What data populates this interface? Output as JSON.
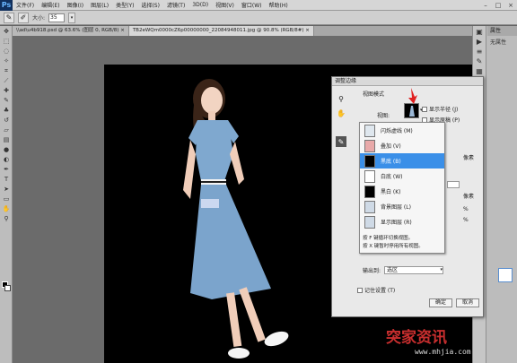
{
  "app": {
    "logo": "Ps"
  },
  "menu": [
    "文件(F)",
    "编辑(E)",
    "图像(I)",
    "图层(L)",
    "类型(Y)",
    "选择(S)",
    "滤镜(T)",
    "3D(D)",
    "视图(V)",
    "窗口(W)",
    "帮助(H)"
  ],
  "window_controls": [
    "–",
    "□",
    "×"
  ],
  "options": {
    "size_label": "大小:",
    "size_value": "35"
  },
  "tabs": [
    "\\\\ad\\u4b918.psd @ 63.6% (图层 0, RGB/8) ×",
    "TB2eWQm0000cZ6p00000000_22084948011.jpg @ 90.8% (RGB/8#) ×"
  ],
  "properties": {
    "title": "属性",
    "subtitle": "无属性"
  },
  "dialog": {
    "title": "调整边缘",
    "section_view_mode": "视图模式",
    "view_label": "视图:",
    "show_radius": "显示半径 (J)",
    "show_original": "显示原稿 (P)",
    "unit_pixel_1": "像素",
    "unit_pixel_2": "像素",
    "unit_percent_1": "%",
    "unit_percent_2": "%",
    "view_options": [
      {
        "label": "闪烁虚线 (M)",
        "thumb": "#dfe7ee"
      },
      {
        "label": "叠加 (V)",
        "thumb": "#e8a9a9"
      },
      {
        "label": "黑底 (B)",
        "thumb": "#000000",
        "highlighted": true
      },
      {
        "label": "白底 (W)",
        "thumb": "#ffffff"
      },
      {
        "label": "黑白 (K)",
        "thumb": "#000000"
      },
      {
        "label": "背景图层 (L)",
        "thumb": "#cfdae6"
      },
      {
        "label": "显示图层 (R)",
        "thumb": "#cfdae6"
      }
    ],
    "hint_1": "按 F 键循环切换视图。",
    "hint_2": "按 X 键暂时停用所有视图。",
    "output_label": "输出到:",
    "output_value": "选区",
    "remember": "记住设置 (T)",
    "ok": "确定",
    "cancel": "取消"
  },
  "watermark": {
    "text": "突家资讯",
    "sub": "www.mhjia.com"
  }
}
